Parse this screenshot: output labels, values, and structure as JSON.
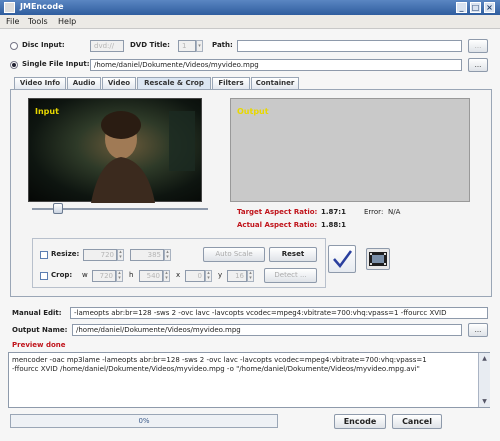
{
  "window": {
    "title": "JMEncode"
  },
  "menu": [
    "File",
    "Tools",
    "Help"
  ],
  "source": {
    "disc_label": "Disc Input:",
    "disc_device": "dvd://",
    "dvd_title_label": "DVD Title:",
    "dvd_title_value": "1",
    "path_label": "Path:",
    "path_value": "",
    "single_label": "Single File Input:",
    "single_value": "/home/daniel/Dokumente/Videos/myvideo.mpg",
    "browse": "..."
  },
  "tabs": [
    "Video Info",
    "Audio",
    "Video",
    "Rescale & Crop",
    "Filters",
    "Container"
  ],
  "active_tab": "Rescale & Crop",
  "preview": {
    "input_label": "Input",
    "output_label": "Output",
    "slider_percent": 15
  },
  "aspect": {
    "target_label": "Target Aspect Ratio:",
    "target_value": "1.87:1",
    "error_label": "Error:",
    "error_value": "N/A",
    "actual_label": "Actual Aspect Ratio:",
    "actual_value": "1.88:1"
  },
  "resize": {
    "label": "Resize:",
    "width": "720",
    "height": "385",
    "auto_scale": "Auto Scale",
    "reset": "Reset"
  },
  "crop": {
    "label": "Crop:",
    "w_label": "w",
    "w": "720",
    "h_label": "h",
    "h": "540",
    "x_label": "x",
    "x": "0",
    "y_label": "y",
    "y": "16",
    "detect": "Detect ..."
  },
  "manual": {
    "label": "Manual Edit:",
    "value": "-lameopts abr:br=128 -sws 2 -ovc lavc -lavcopts vcodec=mpeg4:vbitrate=700:vhq:vpass=1 -ffourcc XVID"
  },
  "output": {
    "label": "Output Name:",
    "value": "/home/daniel/Dokumente/Videos/myvideo.mpg",
    "browse": "..."
  },
  "status": "Preview done",
  "command": {
    "line1": "mencoder -oac mp3lame -lameopts abr:br=128 -sws 2 -ovc lavc -lavcopts vcodec=mpeg4:vbitrate=700:vhq:vpass=1",
    "line2": "-ffourcc XVID    /home/daniel/Dokumente/Videos/myvideo.mpg -o \"/home/daniel/Dokumente/Videos/myvideo.mpg.avi\""
  },
  "progress": {
    "text": "0%",
    "value": 0
  },
  "buttons": {
    "encode": "Encode",
    "cancel": "Cancel"
  },
  "colors": {
    "accent_red": "#c0141b",
    "title_blue": "#2f5d9e",
    "input_label": "#e8d800"
  }
}
